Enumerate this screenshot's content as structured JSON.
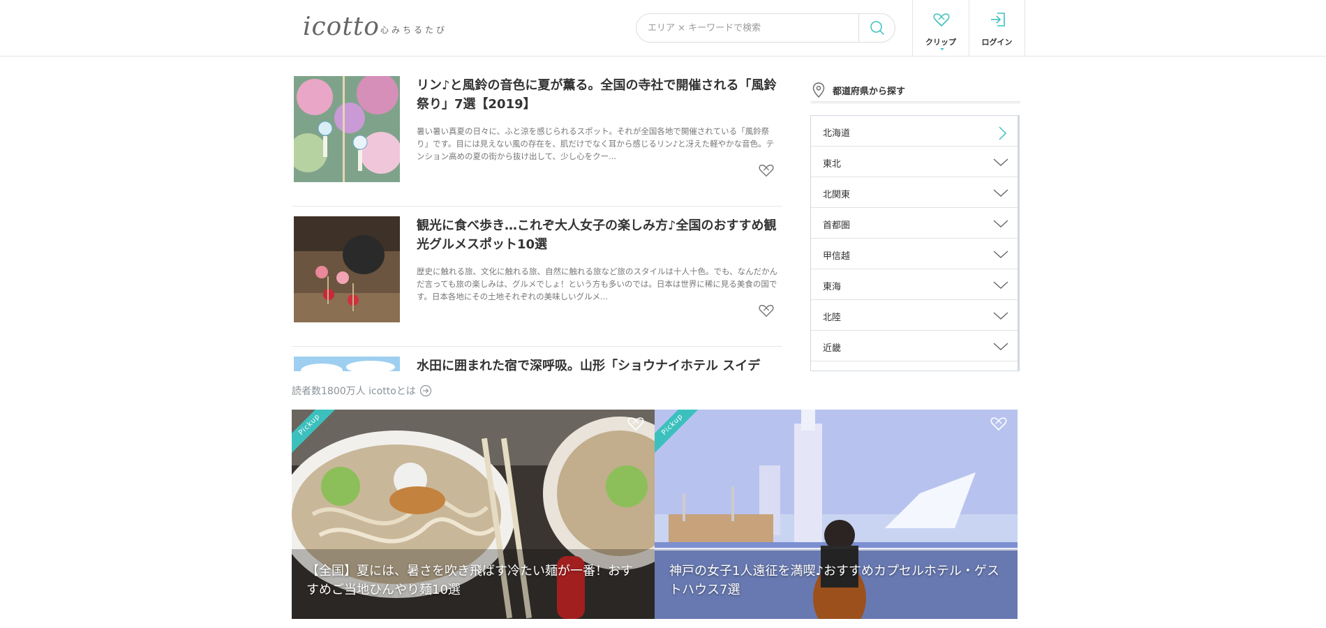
{
  "header": {
    "logo": "icotto",
    "tagline": "心みちるたび",
    "search_placeholder": "エリア × キーワードで検索",
    "clip_label": "クリップ",
    "login_label": "ログイン"
  },
  "articles": [
    {
      "title": "リン♪と風鈴の音色に夏が薫る。全国の寺社で開催される「風鈴祭り」7選【2019】",
      "excerpt": "暑い暑い真夏の日々に、ふと涼を感じられるスポット。それが全国各地で開催されている「風鈴祭り」です。目には見えない風の存在を、肌だけでなく耳から感じるリン♪と冴えた軽やかな音色。テンション高めの夏の街から抜け出して、少し心をクー..."
    },
    {
      "title": "観光に食べ歩き…これぞ大人女子の楽しみ方♪全国のおすすめ観光グルメスポット10選",
      "excerpt": "歴史に触れる旅、文化に触れる旅、自然に触れる旅など旅のスタイルは十人十色。でも、なんだかんだ言っても旅の楽しみは、グルメでしょ！という方も多いのでは。日本は世界に稀に見る美食の国です。日本各地にその土地それぞれの美味しいグルメ..."
    },
    {
      "title": "水田に囲まれた宿で深呼吸。山形「ショウナイホテル スイデ",
      "excerpt": ""
    }
  ],
  "sidebar": {
    "heading": "都道府県から探す",
    "prefectures": [
      "北海道",
      "東北",
      "北関東",
      "首都圏",
      "甲信越",
      "東海",
      "北陸",
      "近畿"
    ]
  },
  "readers_text": "読者数1800万人 icottoとは",
  "pickups": [
    {
      "tag": "Pickup",
      "title": "【全国】夏には、暑さを吹き飛ばす冷たい麺が一番！おすすめご当地ひんやり麺10選"
    },
    {
      "tag": "Pickup",
      "title": "神戸の女子1人遠征を満喫♪おすすめカプセルホテル・ゲストハウス7選"
    }
  ],
  "colors": {
    "accent": "#3cc0bd",
    "border": "#e4e4e4",
    "text": "#333333"
  }
}
